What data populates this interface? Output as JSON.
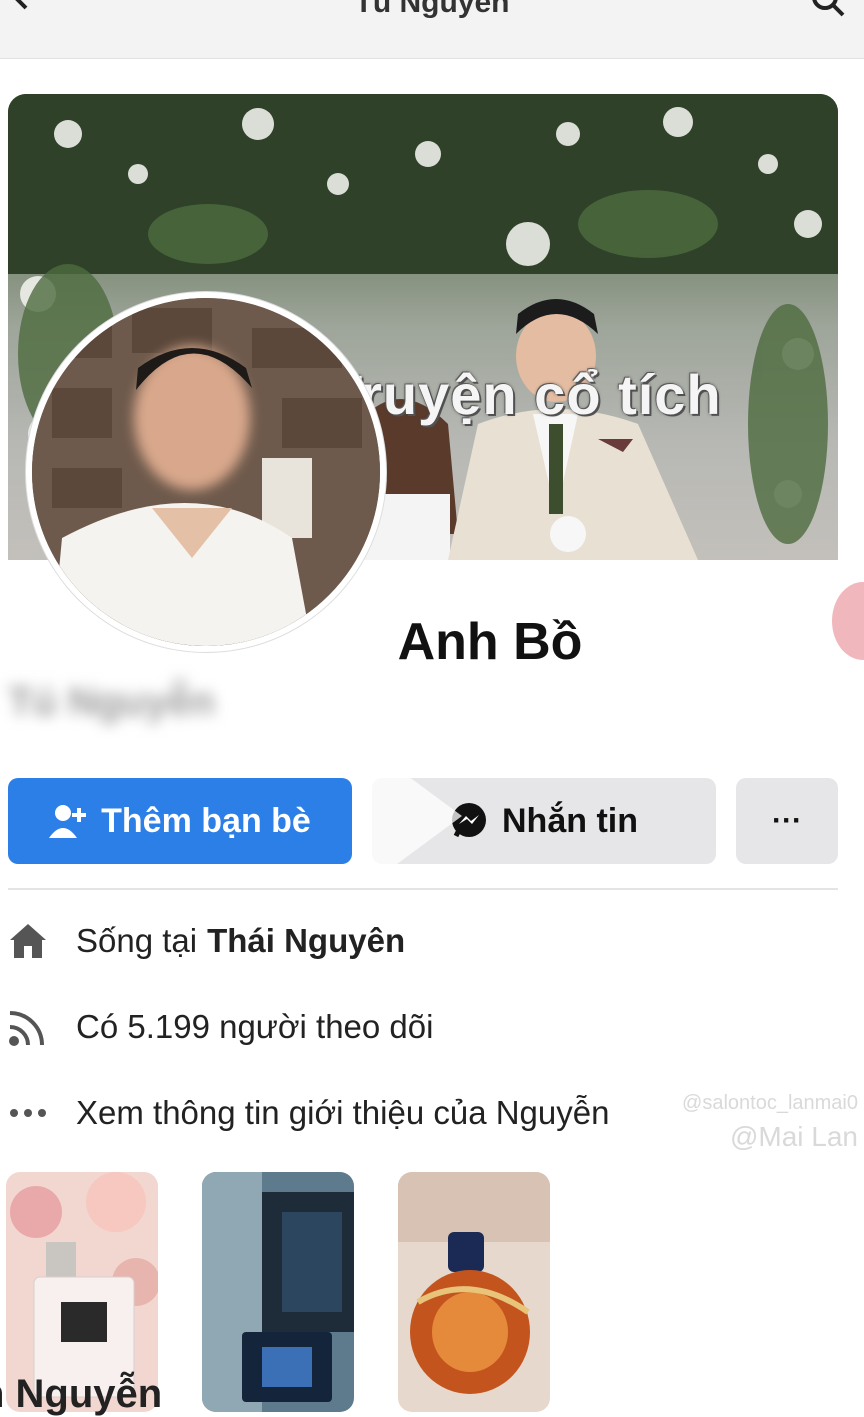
{
  "topbar": {
    "title": "Tú Nguyên"
  },
  "cover": {
    "caption": "Truyện cổ tích"
  },
  "profile": {
    "name": "Anh Bồ",
    "secondary_name": "Tú Nguyễn"
  },
  "actions": {
    "add_friend": "Thêm bạn bè",
    "message": "Nhắn tin",
    "more": "···"
  },
  "info": {
    "lives_prefix": "Sống tại",
    "lives_city": "Thái Nguyên",
    "followers": "Có 5.199 người theo dõi",
    "about": "Xem thông tin giới thiệu của Nguyễn"
  },
  "watermark": {
    "handle": "@salontoc_lanmai0",
    "user": "@Mai Lan"
  },
  "bottom": {
    "partial_name": "n Nguyễn"
  },
  "colors": {
    "primary": "#2d7fe8",
    "button_gray": "#e6e6e8"
  },
  "icons": [
    "back-arrow-icon",
    "search-icon",
    "add-friend-icon",
    "messenger-icon",
    "home-icon",
    "followers-icon",
    "more-dots-icon"
  ]
}
